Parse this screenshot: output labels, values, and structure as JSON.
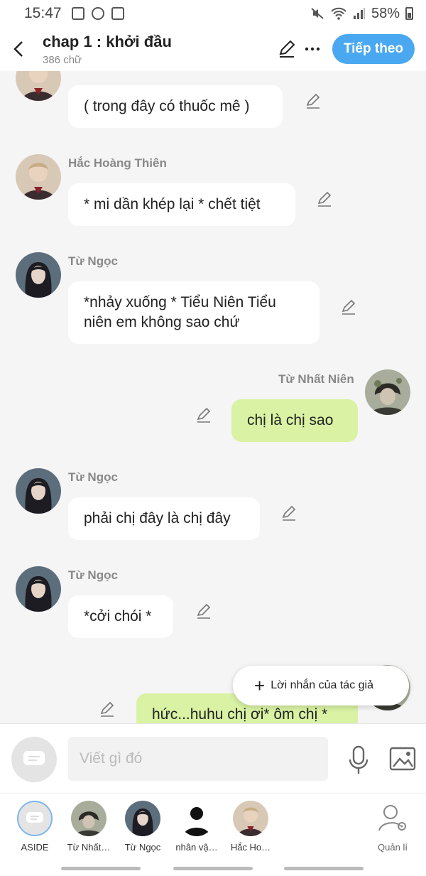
{
  "status": {
    "time": "15:47",
    "battery": "58%"
  },
  "header": {
    "title": "chap 1 : khởi đầu",
    "word_count": "386 chữ",
    "next_label": "Tiếp theo"
  },
  "messages": [
    {
      "name": "",
      "text": "( trong đây có thuốc mê )",
      "side": "left"
    },
    {
      "name": "Hắc Hoàng Thiên",
      "text": "* mi dần khép lại * chết tiệt",
      "side": "left"
    },
    {
      "name": "Từ Ngọc",
      "text": "*nhảy xuống * Tiểu Niên Tiểu niên em không sao chứ",
      "side": "left"
    },
    {
      "name": "Từ Nhất Niên",
      "text": "chị là chị sao",
      "side": "right"
    },
    {
      "name": "Từ Ngọc",
      "text": "phải chị đây là chị đây",
      "side": "left"
    },
    {
      "name": "Từ Ngọc",
      "text": "*cởi chói *",
      "side": "left"
    },
    {
      "name": "",
      "text": "hức...huhu chị ơi* ôm chị *",
      "side": "right"
    }
  ],
  "author_note_label": "Lời nhắn của tác giả",
  "composer": {
    "placeholder": "Viết gì đó"
  },
  "characters": [
    {
      "label": "ASIDE"
    },
    {
      "label": "Từ Nhất…"
    },
    {
      "label": "Từ Ngọc"
    },
    {
      "label": "nhân vậ…"
    },
    {
      "label": "Hắc Ho…"
    },
    {
      "label": "Quản lí"
    }
  ],
  "colors": {
    "accent": "#4aa8f0",
    "my_bubble": "#d9f2a3",
    "background": "#f5f5f5"
  }
}
